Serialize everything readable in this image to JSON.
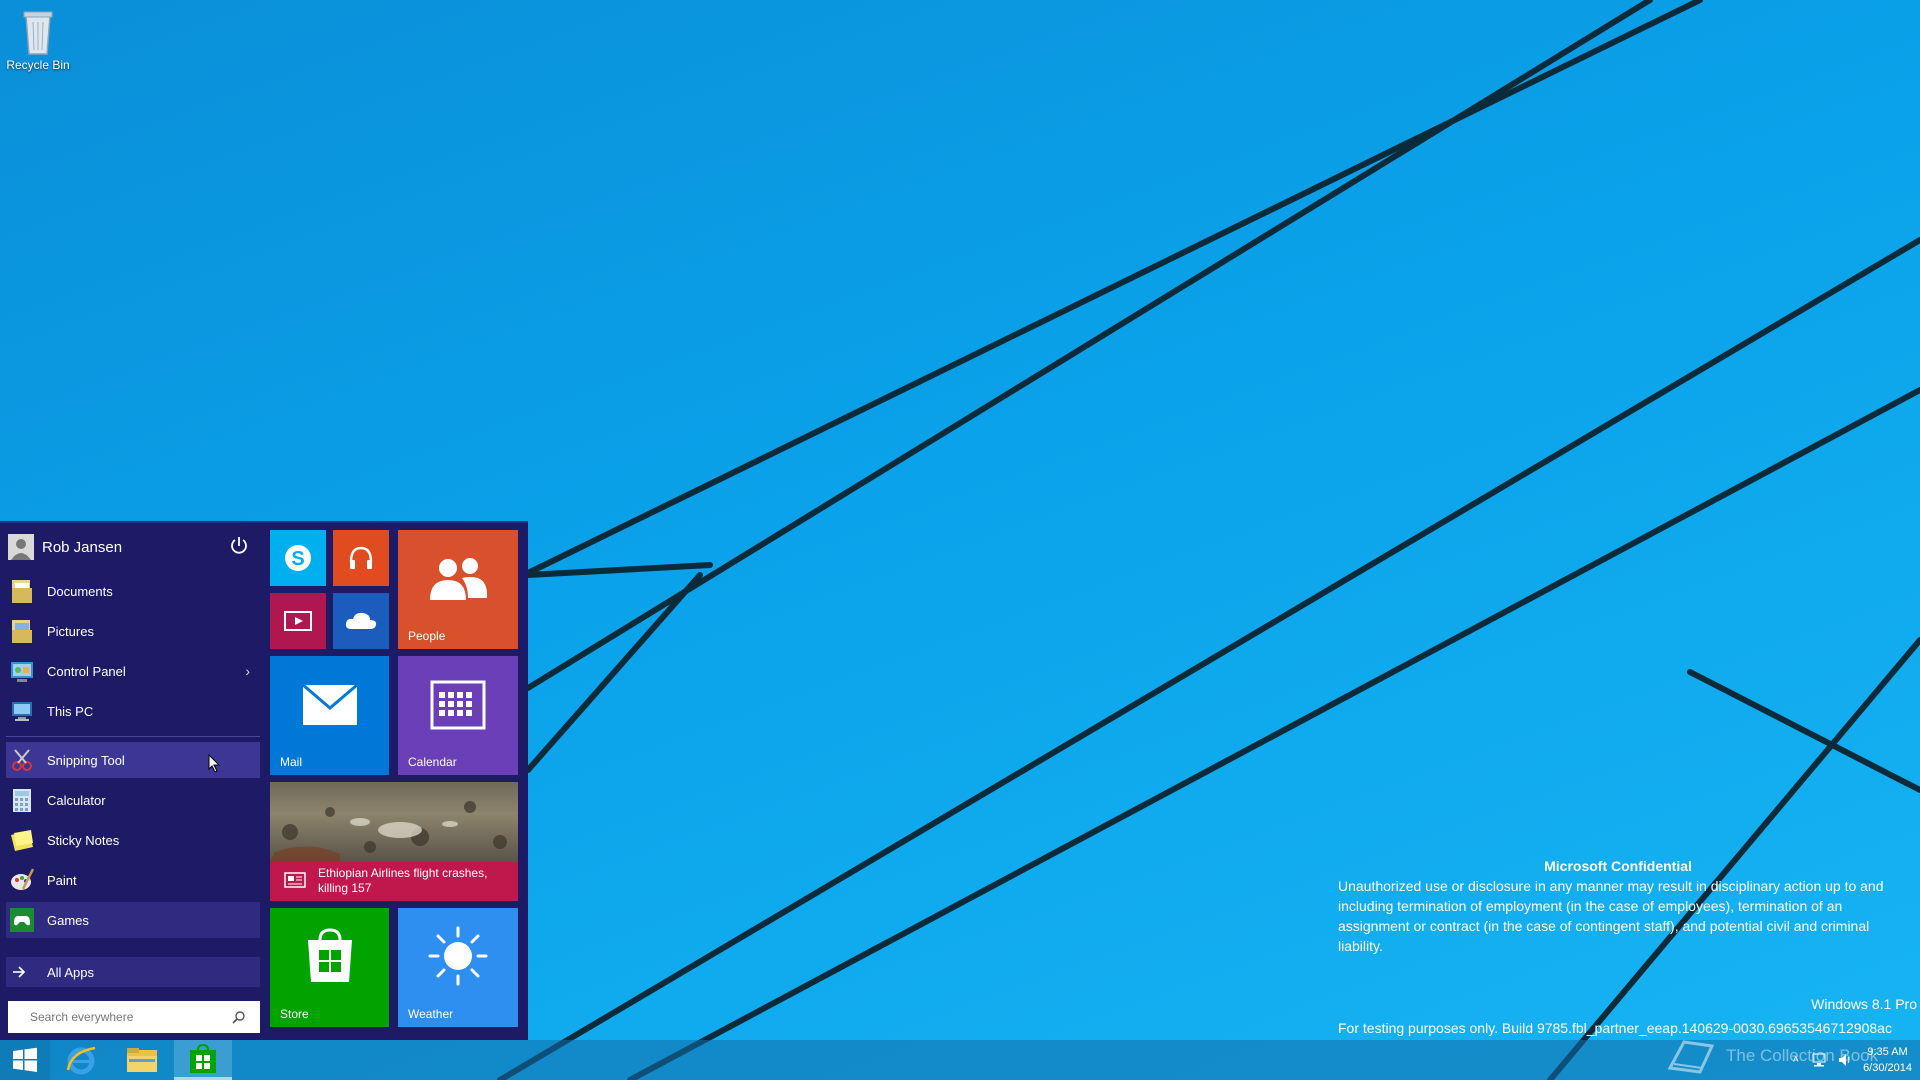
{
  "desktop": {
    "icons": [
      {
        "label": "Recycle Bin",
        "icon": "recycle-bin-icon"
      }
    ]
  },
  "start_menu": {
    "user": {
      "name": "Rob Jansen"
    },
    "places": [
      {
        "label": "Documents",
        "icon": "documents-folder-icon"
      },
      {
        "label": "Pictures",
        "icon": "pictures-folder-icon"
      },
      {
        "label": "Control Panel",
        "icon": "control-panel-icon",
        "has_submenu": true
      },
      {
        "label": "This PC",
        "icon": "this-pc-icon"
      }
    ],
    "apps": [
      {
        "label": "Snipping Tool",
        "icon": "snipping-tool-icon",
        "highlighted": true
      },
      {
        "label": "Calculator",
        "icon": "calculator-icon"
      },
      {
        "label": "Sticky Notes",
        "icon": "sticky-notes-icon"
      },
      {
        "label": "Paint",
        "icon": "paint-icon"
      },
      {
        "label": "Games",
        "icon": "games-icon"
      }
    ],
    "all_apps_label": "All Apps",
    "search": {
      "placeholder": "Search everywhere",
      "value": ""
    },
    "tiles": [
      {
        "id": "skype",
        "label": "",
        "icon": "skype-icon",
        "color": "#00aff0"
      },
      {
        "id": "music",
        "label": "",
        "icon": "headphones-icon",
        "color": "#e04b1f"
      },
      {
        "id": "video",
        "label": "",
        "icon": "video-icon",
        "color": "#b0164f"
      },
      {
        "id": "onedrive",
        "label": "",
        "icon": "cloud-icon",
        "color": "#1a5dbd"
      },
      {
        "id": "people",
        "label": "People",
        "icon": "people-icon",
        "color": "#d9512c"
      },
      {
        "id": "mail",
        "label": "Mail",
        "icon": "mail-icon",
        "color": "#0078d7"
      },
      {
        "id": "calendar",
        "label": "Calendar",
        "icon": "calendar-icon",
        "color": "#6a3fb8"
      },
      {
        "id": "news",
        "label": "Ethiopian Airlines flight crashes, killing 157",
        "icon": "news-icon",
        "color": "#c0174c"
      },
      {
        "id": "store",
        "label": "Store",
        "icon": "store-icon",
        "color": "#00a300"
      },
      {
        "id": "weather",
        "label": "Weather",
        "icon": "weather-sun-icon",
        "color": "#2e8ff0"
      }
    ]
  },
  "taskbar": {
    "items": [
      {
        "name": "start-button",
        "icon": "windows-logo-icon"
      },
      {
        "name": "internet-explorer",
        "icon": "internet-explorer-icon"
      },
      {
        "name": "file-explorer",
        "icon": "file-explorer-icon"
      },
      {
        "name": "store",
        "icon": "store-icon"
      }
    ],
    "clock": {
      "time": "9:35 AM",
      "date": "6/30/2014"
    }
  },
  "overlay": {
    "confidential_title": "Microsoft Confidential",
    "confidential_body": "Unauthorized use or disclosure in any manner may result in disciplinary action up to and including termination of employment (in the case of employees), termination of an assignment or contract (in the case of contingent staff), and potential civil and criminal liability.",
    "edition": "Windows 8.1 Pro",
    "build": "For testing purposes only. Build 9785.fbl_partner_eeap.140629-0030.69653546712908ac",
    "watermark": "The Collection Book"
  }
}
